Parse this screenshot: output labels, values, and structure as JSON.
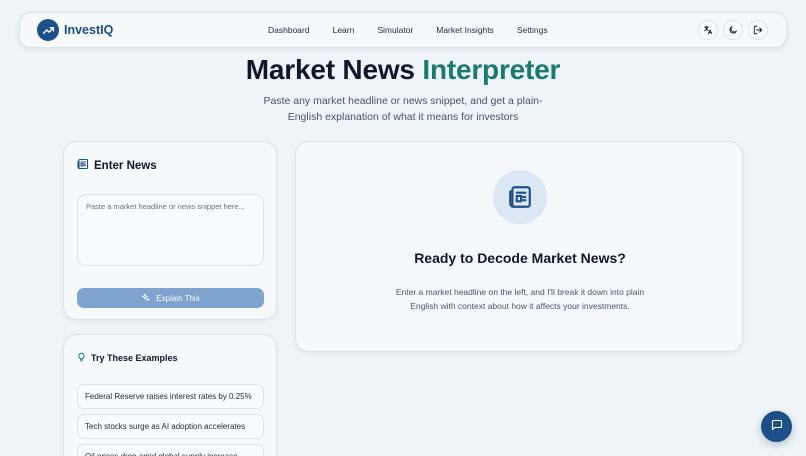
{
  "brand": {
    "name": "InvestIQ"
  },
  "nav": {
    "links": [
      "Dashboard",
      "Learn",
      "Simulator",
      "Market Insights",
      "Settings"
    ],
    "icons": [
      "translate-icon",
      "moon-icon",
      "logout-icon"
    ]
  },
  "hero": {
    "title_main": "Market News",
    "title_accent": "Interpreter",
    "subtitle": "Paste any market headline or news snippet, and get a plain-English explanation of what it means for investors"
  },
  "enter_news": {
    "heading": "Enter News",
    "placeholder": "Paste a market headline or news snippet here...",
    "button_label": "Explain This"
  },
  "examples": {
    "heading": "Try These Examples",
    "items": [
      "Federal Reserve raises interest rates by 0.25%",
      "Tech stocks surge as AI adoption accelerates",
      "Oil prices drop amid global supply increase"
    ]
  },
  "ready": {
    "title": "Ready to Decode Market News?",
    "description": "Enter a market headline on the left, and I'll break it down into plain English with context about how it affects your investments."
  },
  "colors": {
    "primary": "#1e4f8a",
    "accent": "#1a7a72",
    "background": "#eef4f8",
    "button_disabled": "#7ea3cc"
  }
}
